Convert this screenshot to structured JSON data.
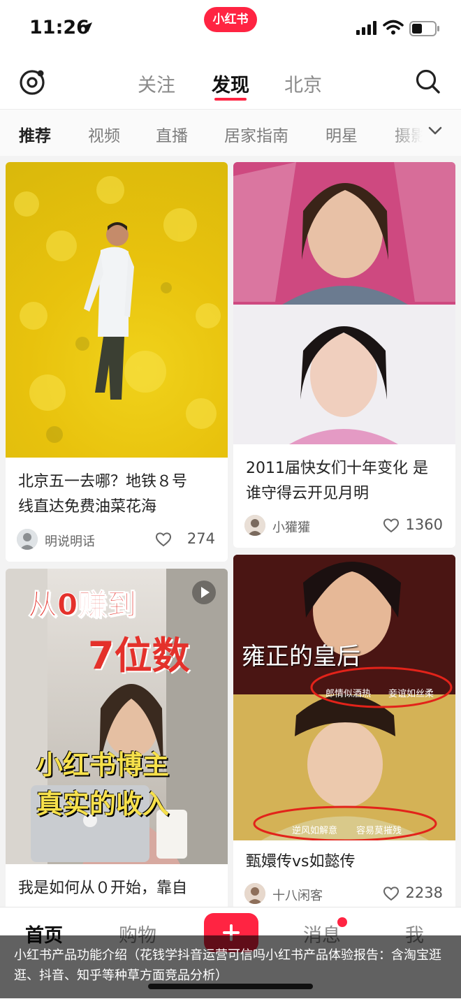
{
  "status_bar": {
    "time": "11:26",
    "app_badge": "小红书"
  },
  "top_nav": {
    "tabs": [
      {
        "label": "关注",
        "active": false
      },
      {
        "label": "发现",
        "active": true
      },
      {
        "label": "北京",
        "active": false
      }
    ]
  },
  "categories": [
    "推荐",
    "视频",
    "直播",
    "居家指南",
    "明星",
    "摄影"
  ],
  "feed": {
    "cards": [
      {
        "title_lines": [
          "北京五一去哪？地铁８号",
          "线直达免费油菜花海"
        ],
        "author": "明说明话",
        "likes": "274"
      },
      {
        "title_lines": [
          "2011届快女们十年变化 是",
          "谁守得云开见月明"
        ],
        "author": "小獾獾",
        "likes": "1360"
      },
      {
        "image_text": [
          "从0赚到",
          "7位数",
          "小红书博主",
          "真实的收入"
        ],
        "title_lines": [
          "我是如何从０开始，靠自"
        ],
        "author": "",
        "likes": ""
      },
      {
        "image_text": [
          "雍正的皇后",
          "郎情似酒热",
          "妾谊如丝柔",
          "逆风如解意",
          "容易莫摧残"
        ],
        "title_lines": [
          "甄嬛传vs如懿传"
        ],
        "author": "十八闲客",
        "likes": "2238"
      }
    ]
  },
  "bottom_nav": {
    "items": [
      {
        "label": "首页",
        "active": true
      },
      {
        "label": "购物",
        "active": false
      },
      {
        "label": "消息",
        "active": false
      },
      {
        "label": "我",
        "active": false
      }
    ]
  },
  "caption": "小红书产品功能介绍（花钱学抖音运营可信吗小红书产品体验报告：含淘宝逛逛、抖音、知乎等种草方面竞品分析）",
  "colors": {
    "accent": "#ff2442",
    "rapeseed": "#e8c20d"
  },
  "icons": [
    "location-arrow-icon",
    "signal-icon",
    "wifi-icon",
    "battery-icon",
    "camera-icon",
    "search-icon",
    "chevron-down-icon",
    "heart-icon",
    "play-icon",
    "plus-icon"
  ]
}
